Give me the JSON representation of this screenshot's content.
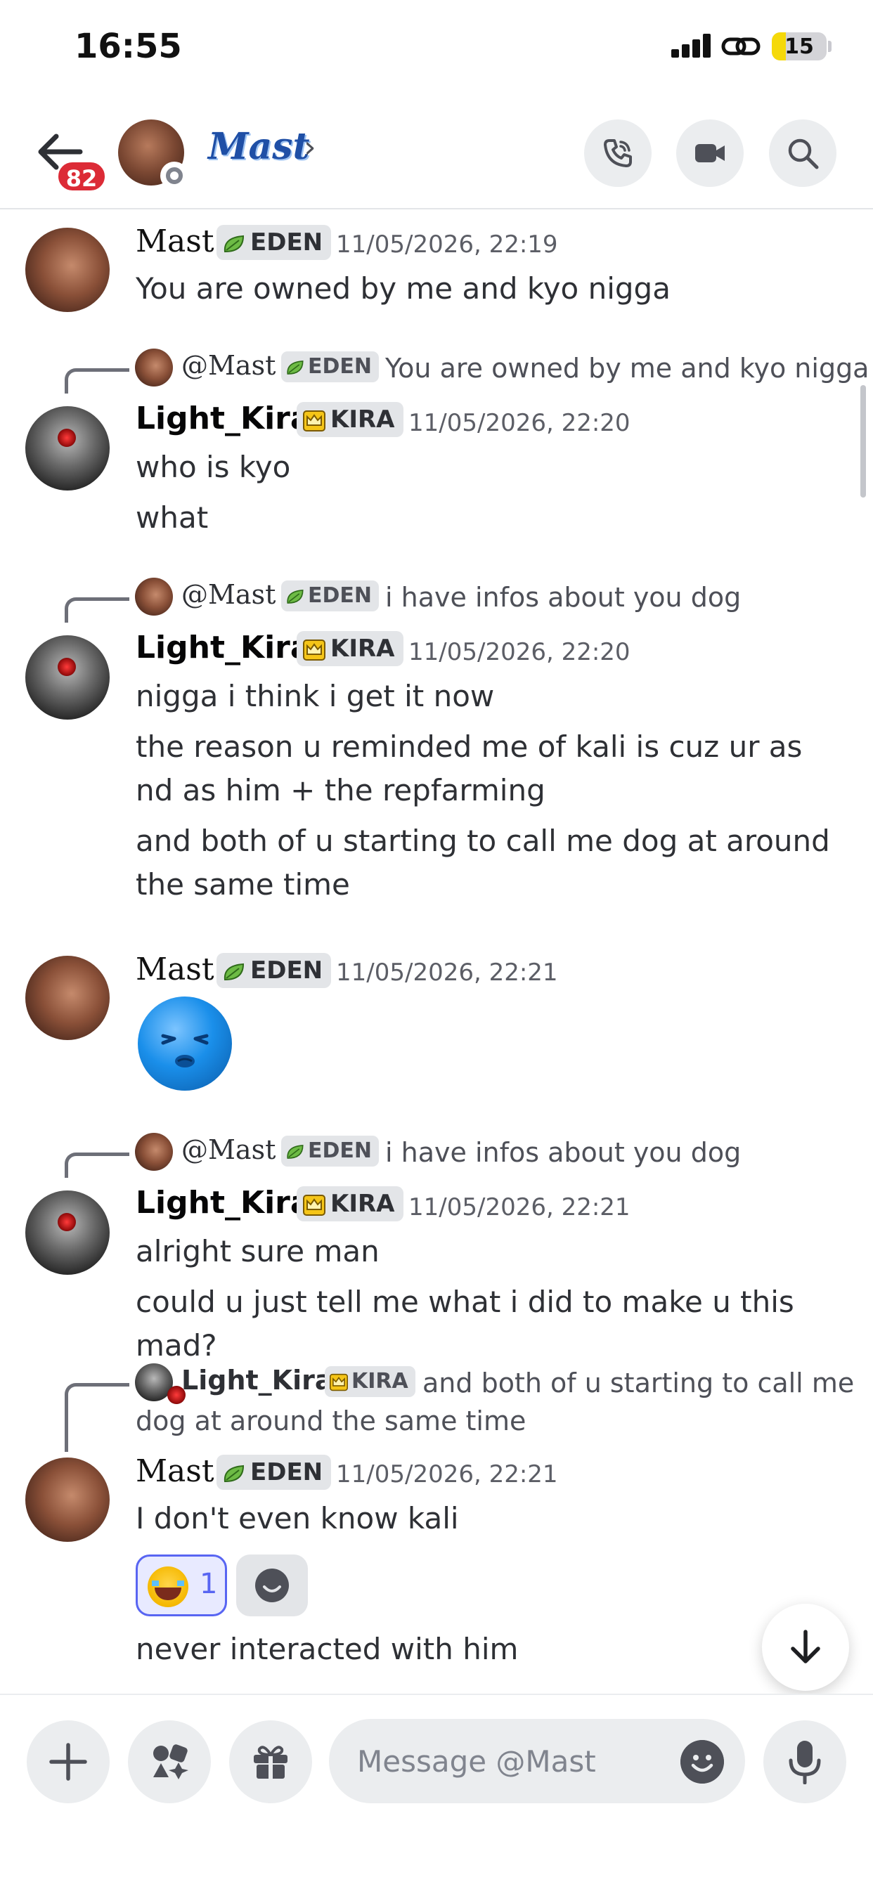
{
  "status_bar": {
    "time": "16:55",
    "battery": "15"
  },
  "header": {
    "back_badge": "82",
    "dm_name": "Mast"
  },
  "messages": [
    {
      "author": "Mast",
      "tag": "EDEN",
      "time": "11/05/2026, 22:19",
      "lines": [
        "You are owned by me and kyo nigga"
      ]
    },
    {
      "reply": {
        "name": "@Mast",
        "tag": "EDEN",
        "text": "You are owned by me and kyo nigga"
      },
      "author": "Light_Kira",
      "tag": "KIRA",
      "time": "11/05/2026, 22:20",
      "lines": [
        "who is kyo",
        "what"
      ]
    },
    {
      "reply": {
        "name": "@Mast",
        "tag": "EDEN",
        "text": "i have infos about you dog"
      },
      "author": "Light_Kira",
      "tag": "KIRA",
      "time": "11/05/2026, 22:20",
      "lines": [
        "nigga i think i get it now",
        "the reason u reminded me of kali is cuz ur as nd as him + the repfarming",
        "and both of u starting to call me  dog at around the same time"
      ]
    },
    {
      "author": "Mast",
      "tag": "EDEN",
      "time": "11/05/2026, 22:21",
      "lines": []
    },
    {
      "reply": {
        "name": "@Mast",
        "tag": "EDEN",
        "text": "i have infos about you dog"
      },
      "author": "Light_Kira",
      "tag": "KIRA",
      "time": "11/05/2026, 22:21",
      "lines": [
        "alright sure man",
        "could u just tell me what i did to make u this mad?"
      ]
    },
    {
      "reply": {
        "name": "Light_Kira",
        "tag": "KIRA",
        "text": "and both of u starting to call me",
        "text2": "dog at around the same time"
      },
      "author": "Mast",
      "tag": "EDEN",
      "time": "11/05/2026, 22:21",
      "lines": [
        "I don't even know kali",
        "never interacted with him"
      ],
      "reaction": {
        "emoji": "joy-emoji",
        "count": "1"
      }
    }
  ],
  "composer": {
    "placeholder": "Message @Mast"
  },
  "colors": {
    "accent": "#5865f2",
    "badge": "#dc2b36",
    "battery_fill": "#f5d90a",
    "name_blue": "#1f4fa6"
  }
}
